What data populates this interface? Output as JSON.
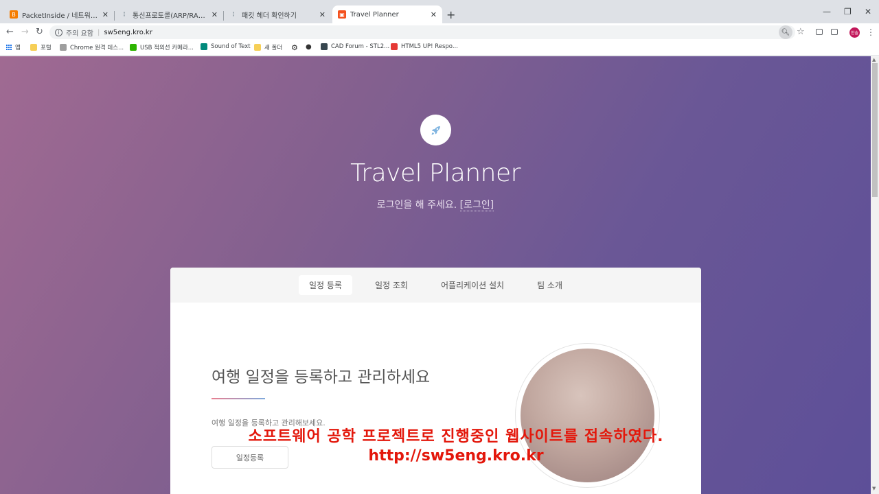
{
  "browser": {
    "tabs": [
      {
        "title": "PacketInside / 네트워크 패킷 분",
        "favicon_color": "#f57c00",
        "active": false
      },
      {
        "title": "통신프로토콜(ARP/RARP)연습문",
        "favicon_color": "#455a64",
        "active": false
      },
      {
        "title": "패킷 헤더 확인하기",
        "favicon_color": "#455a64",
        "active": false
      },
      {
        "title": "Travel Planner",
        "favicon_color": "#f4511e",
        "active": true
      }
    ],
    "address": {
      "security_label": "주의 요함",
      "url": "sw5eng.kro.kr"
    },
    "bookmarks": [
      {
        "label": "앱",
        "icon": "apps-icon"
      },
      {
        "label": "포털",
        "icon": "folder-icon"
      },
      {
        "label": "Chrome 원격 데스...",
        "icon": "remote-desktop-icon"
      },
      {
        "label": "USB 적외선 카메라...",
        "icon": "naver-icon"
      },
      {
        "label": "Sound of Text",
        "icon": "sound-icon"
      },
      {
        "label": "새 폴더",
        "icon": "folder-icon"
      },
      {
        "label": "",
        "icon": "gear-icon"
      },
      {
        "label": "",
        "icon": "globe-icon"
      },
      {
        "label": "CAD Forum - STL2...",
        "icon": "cad-icon"
      },
      {
        "label": "HTML5 UP! Respo...",
        "icon": "html5up-icon"
      }
    ],
    "profile_initial": "한솔"
  },
  "page": {
    "site_title": "Travel Planner",
    "login_prompt": "로그인을 해 주세요.",
    "login_link": "[로그인]",
    "nav": [
      {
        "label": "일정 등록",
        "active": true
      },
      {
        "label": "일정 조회",
        "active": false
      },
      {
        "label": "어플리케이션 설치",
        "active": false
      },
      {
        "label": "팀 소개",
        "active": false
      }
    ],
    "intro_title": "여행 일정을 등록하고 관리하세요",
    "intro_sub": "여행 일정을 등록하고 관리해보세요.",
    "register_button": "일정등록"
  },
  "overlay": {
    "line1": "소프트웨어 공학 프로젝트로 진행중인 웹사이트를 접속하였다.",
    "line2": "http://sw5eng.kro.kr"
  }
}
